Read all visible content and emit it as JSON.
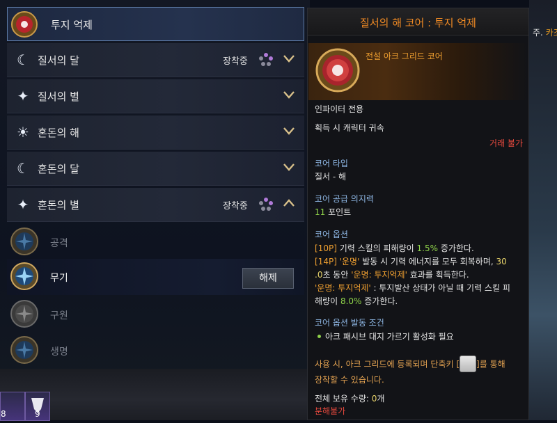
{
  "corner": {
    "text": "주.",
    "accent": "카조"
  },
  "list": {
    "selected": {
      "name": "투지 억제"
    },
    "rows": [
      {
        "name": "질서의 달",
        "state": "장착중",
        "chevron": "down",
        "icon": "moon-icon"
      },
      {
        "name": "질서의 별",
        "state": "",
        "chevron": "down",
        "icon": "star-icon"
      },
      {
        "name": "혼돈의 해",
        "state": "",
        "chevron": "down",
        "icon": "sun-icon"
      },
      {
        "name": "혼돈의 달",
        "state": "",
        "chevron": "down",
        "icon": "moon-icon"
      },
      {
        "name": "혼돈의 별",
        "state": "장착중",
        "chevron": "up",
        "icon": "star-icon"
      }
    ],
    "gems": [
      {
        "label": "공격",
        "style": "dim"
      },
      {
        "label": "무기",
        "style": "bright",
        "button": "해제"
      },
      {
        "label": "구원",
        "style": "dim"
      },
      {
        "label": "생명",
        "style": "dim"
      }
    ]
  },
  "bottom_icons": [
    {
      "count": "8"
    },
    {
      "count": "9"
    }
  ],
  "tooltip": {
    "title": "질서의 해 코어 : 투지 억제",
    "grade": "전설 아크 그리드 코어",
    "class_only": "인파이터 전용",
    "bind": "획득 시 캐릭터 귀속",
    "trade": "거래 불가",
    "core_type_label": "코어 타입",
    "core_type_value": "질서 - 해",
    "will_label": "코어 공급 의지력",
    "will_value": "11",
    "will_unit": " 포인트",
    "options_label": "코어 옵션",
    "opt1_tag": "[10P]",
    "opt1_a": " 기력 스킬의 피해량이 ",
    "opt1_val": "1.5%",
    "opt1_b": " 증가한다.",
    "opt2_tag": "[14P]",
    "opt2_name": " '운명'",
    "opt2_a": " 발동 시 기력 에너지를 모두 회복하며, ",
    "opt2_num1": "30",
    "opt2_num2": ".0",
    "opt2_b": "초 동안 ",
    "opt2_buff": "'운명: 투지억제'",
    "opt2_c": " 효과를 획득한다.",
    "opt3_name": "'운명: 투지억제'",
    "opt3_a": " : 투지발산 상태가 아닐 때 기력 스킬 피",
    "opt3_b": "해량이 ",
    "opt3_val": "8.0%",
    "opt3_c": " 증가한다.",
    "cond_label": "코어 옵션 발동 조건",
    "cond_value": "아크 패시브 대지 가르기 활성화 필요",
    "use_a": "사용 시, 아크 그리드에 등록되며 단축키 [",
    "use_b": "]를 통해",
    "use_c": "장착할 수 있습니다.",
    "own_label": "전체 보유 수량: ",
    "own_value": "0",
    "own_unit": "개",
    "disassemble": "분해불가"
  }
}
